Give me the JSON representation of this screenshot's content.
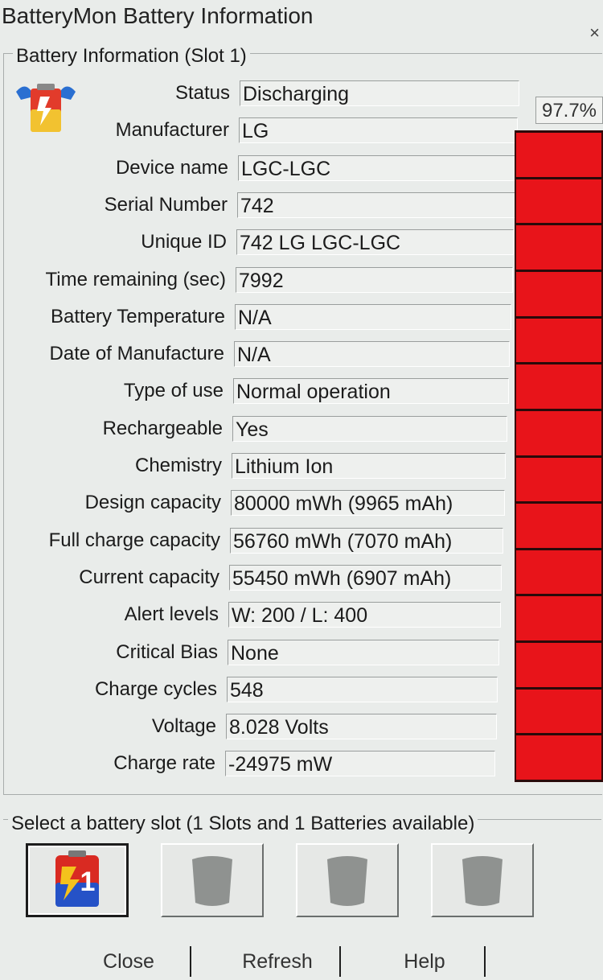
{
  "window": {
    "title": "BatteryMon Battery Information",
    "close_glyph": "×"
  },
  "info_group": {
    "legend": "Battery Information (Slot 1)",
    "icon": "battery-info-icon",
    "fields": [
      {
        "label": "Status",
        "value": "Discharging"
      },
      {
        "label": "Manufacturer",
        "value": "LG"
      },
      {
        "label": "Device name",
        "value": "LGC-LGC"
      },
      {
        "label": "Serial Number",
        "value": "742"
      },
      {
        "label": "Unique ID",
        "value": "742 LG LGC-LGC"
      },
      {
        "label": "Time remaining (sec)",
        "value": "7992"
      },
      {
        "label": "Battery Temperature",
        "value": "N/A"
      },
      {
        "label": "Date of Manufacture",
        "value": "N/A"
      },
      {
        "label": "Type of use",
        "value": "Normal operation"
      },
      {
        "label": "Rechargeable",
        "value": "Yes"
      },
      {
        "label": "Chemistry",
        "value": "Lithium Ion"
      },
      {
        "label": "Design capacity",
        "value": "80000 mWh (9965 mAh)"
      },
      {
        "label": "Full charge capacity",
        "value": "56760 mWh (7070 mAh)"
      },
      {
        "label": "Current capacity",
        "value": "55450 mWh (6907 mAh)"
      },
      {
        "label": "Alert levels",
        "value": "W: 200 / L: 400"
      },
      {
        "label": "Critical Bias",
        "value": "None"
      },
      {
        "label": "Charge cycles",
        "value": "548"
      },
      {
        "label": "Voltage",
        "value": "8.028 Volts"
      },
      {
        "label": "Charge rate",
        "value": "-24975 mW"
      }
    ]
  },
  "gauge": {
    "percent_label": "97.7%",
    "level_fraction": 0.977,
    "bar_color": "#e8141a",
    "segments": 14
  },
  "slot_group": {
    "legend": "Select a battery slot (1 Slots and 1 Batteries available)",
    "slots": [
      {
        "number": "1",
        "state": "active",
        "icon": "battery-slot-1-icon"
      },
      {
        "number": "",
        "state": "empty",
        "icon": "empty-slot-icon"
      },
      {
        "number": "",
        "state": "empty",
        "icon": "empty-slot-icon"
      },
      {
        "number": "",
        "state": "empty",
        "icon": "empty-slot-icon"
      }
    ]
  },
  "buttons": {
    "close": "Close",
    "refresh": "Refresh",
    "help": "Help"
  }
}
